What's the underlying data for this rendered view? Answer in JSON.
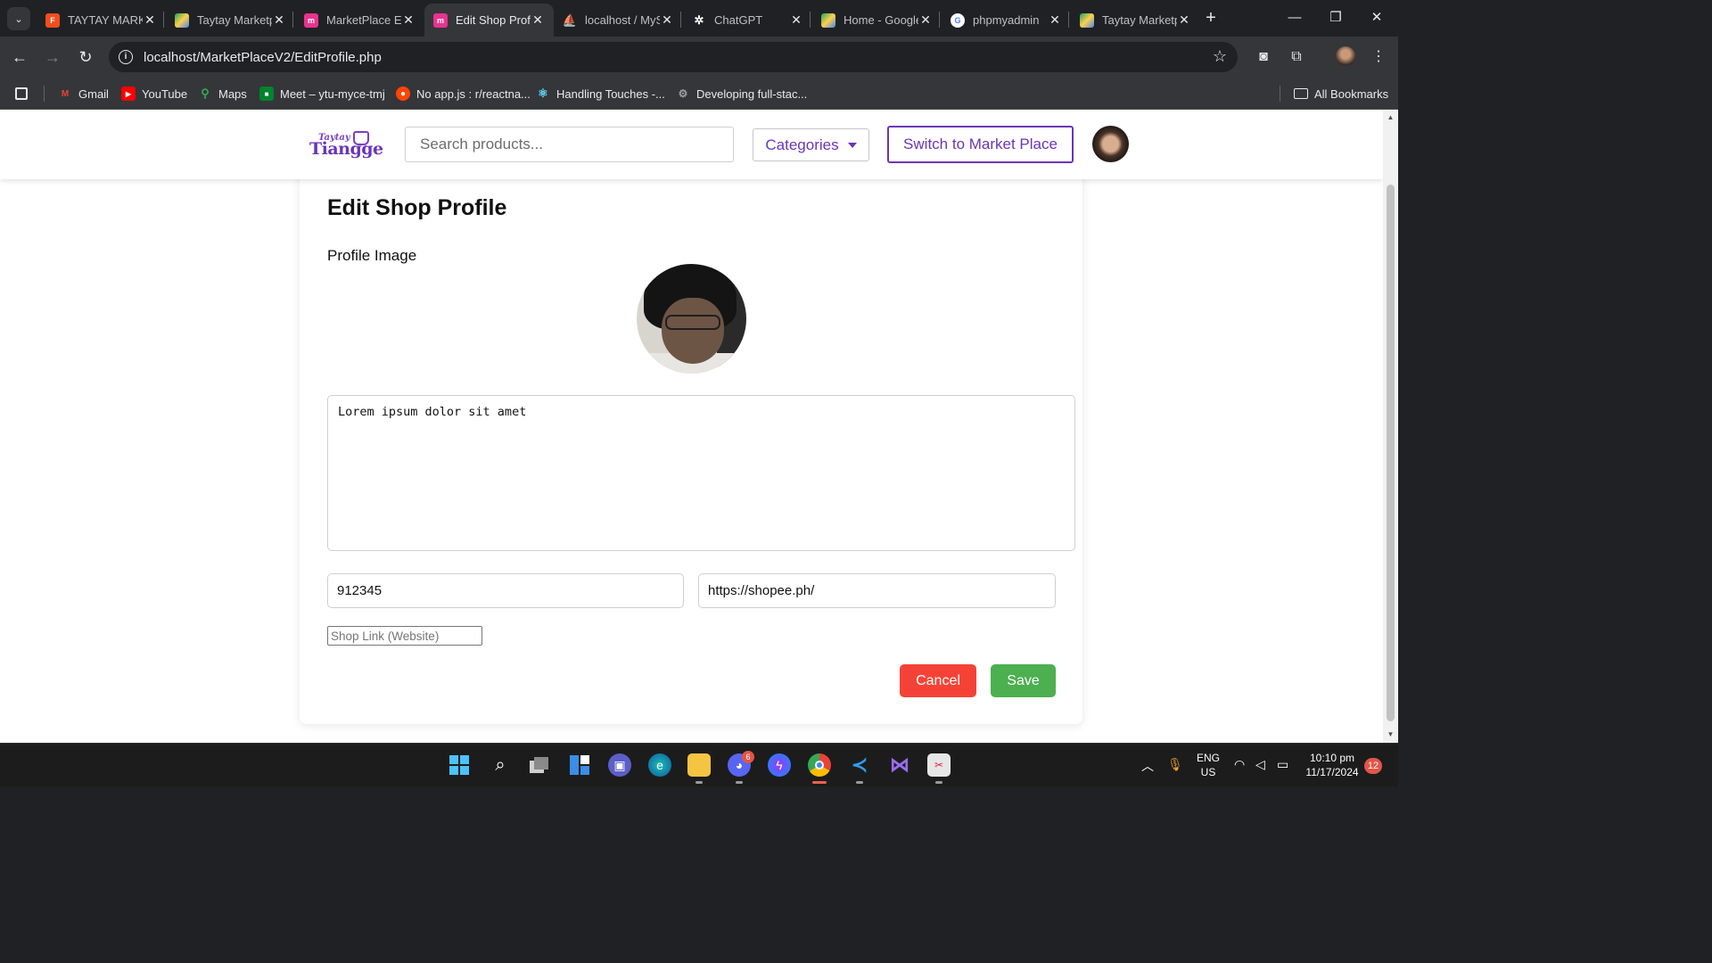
{
  "browser": {
    "tabs": [
      {
        "title": "TAYTAY MARKETPLACE",
        "favicon": "figma-icon",
        "color": "#a259ff"
      },
      {
        "title": "Taytay Marketplace",
        "favicon": "drive-icon",
        "color": "#1fa463"
      },
      {
        "title": "MarketPlace Edit",
        "favicon": "marketplace-icon",
        "color": "#e8338f"
      },
      {
        "title": "Edit Shop Profile",
        "favicon": "marketplace-icon",
        "color": "#e8338f",
        "active": true
      },
      {
        "title": "localhost / MySQL",
        "favicon": "phpmyadmin-icon",
        "color": "#f5a623"
      },
      {
        "title": "ChatGPT",
        "favicon": "chatgpt-icon",
        "color": "#ffffff"
      },
      {
        "title": "Home - Google Drive",
        "favicon": "drive-icon",
        "color": "#1fa463"
      },
      {
        "title": "phpmyadmin",
        "favicon": "google-icon",
        "color": "#4285f4"
      },
      {
        "title": "Taytay Marketplace",
        "favicon": "drive-icon",
        "color": "#1fa463"
      }
    ],
    "tab_close": "✕",
    "new_tab": "+",
    "url": "localhost/MarketPlaceV2/EditProfile.php",
    "bookmarks": [
      {
        "label": "Gmail",
        "icon": "gmail-icon"
      },
      {
        "label": "YouTube",
        "icon": "youtube-icon"
      },
      {
        "label": "Maps",
        "icon": "maps-icon"
      },
      {
        "label": "Meet – ytu-myce-tmj",
        "icon": "meet-icon"
      },
      {
        "label": "No app.js : r/reactna...",
        "icon": "reddit-icon"
      },
      {
        "label": "Handling Touches -...",
        "icon": "react-icon"
      },
      {
        "label": "Developing full-stac...",
        "icon": "devto-icon"
      }
    ],
    "all_bookmarks": "All Bookmarks"
  },
  "site": {
    "logo_top": "Taytay",
    "logo_bottom": "Tiangge",
    "search_placeholder": "Search products...",
    "categories_label": "Categories",
    "switch_label": "Switch to Market Place"
  },
  "form": {
    "title": "Edit Shop Profile",
    "image_label": "Profile Image",
    "description": "Lorem ipsum dolor sit amet",
    "contact_value": "912345",
    "link_value": "https://shopee.ph/",
    "shop_link_placeholder": "Shop Link (Website)",
    "cancel_label": "Cancel",
    "save_label": "Save"
  },
  "taskbar": {
    "apps": [
      "start-icon",
      "search-icon",
      "task-view-icon",
      "widgets-icon",
      "teams-icon",
      "edge-icon",
      "file-explorer-icon",
      "discord-icon",
      "messenger-icon",
      "chrome-icon",
      "vscode-icon",
      "visual-studio-icon",
      "snipping-tool-icon"
    ],
    "discord_badge": "6",
    "lang_top": "ENG",
    "lang_bottom": "US",
    "time": "10:10 pm",
    "date": "11/17/2024",
    "notifications": "12"
  }
}
